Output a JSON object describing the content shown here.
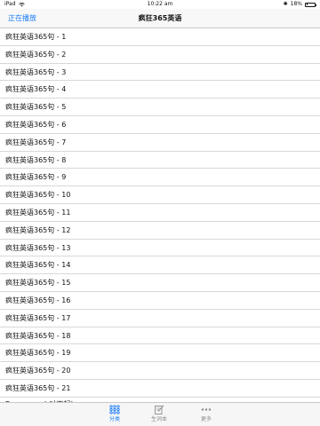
{
  "status_bar": {
    "device": "iPad",
    "time": "10:22 am",
    "battery": "18%",
    "battery_level": 0.18
  },
  "nav": {
    "left_button": "正在播放",
    "title": "疯狂365英语"
  },
  "list": {
    "items": [
      "疯狂英语365句 - 1",
      "疯狂英语365句 - 2",
      "疯狂英语365句 - 3",
      "疯狂英语365句 - 4",
      "疯狂英语365句 - 5",
      "疯狂英语365句 - 6",
      "疯狂英语365句 - 7",
      "疯狂英语365句 - 8",
      "疯狂英语365句 - 9",
      "疯狂英语365句 - 10",
      "疯狂英语365句 - 11",
      "疯狂英语365句 - 12",
      "疯狂英语365句 - 13",
      "疯狂英语365句 - 14",
      "疯狂英语365句 - 15",
      "疯狂英语365句 - 16",
      "疯狂英语365句 - 17",
      "疯狂英语365句 - 18",
      "疯狂英语365句 - 19",
      "疯狂英语365句 - 20",
      "疯狂英语365句 - 21"
    ],
    "partial_item": "Excuse me! 对不起!"
  },
  "tab_bar": {
    "tabs": [
      {
        "label": "分类",
        "icon": "grid-icon",
        "active": true
      },
      {
        "label": "生词本",
        "icon": "notebook-edit-icon",
        "active": false
      },
      {
        "label": "更多",
        "icon": "more-dots-icon",
        "active": false
      }
    ]
  },
  "colors": {
    "accent": "#1a7cf5",
    "inactive": "#8c8c8c"
  }
}
